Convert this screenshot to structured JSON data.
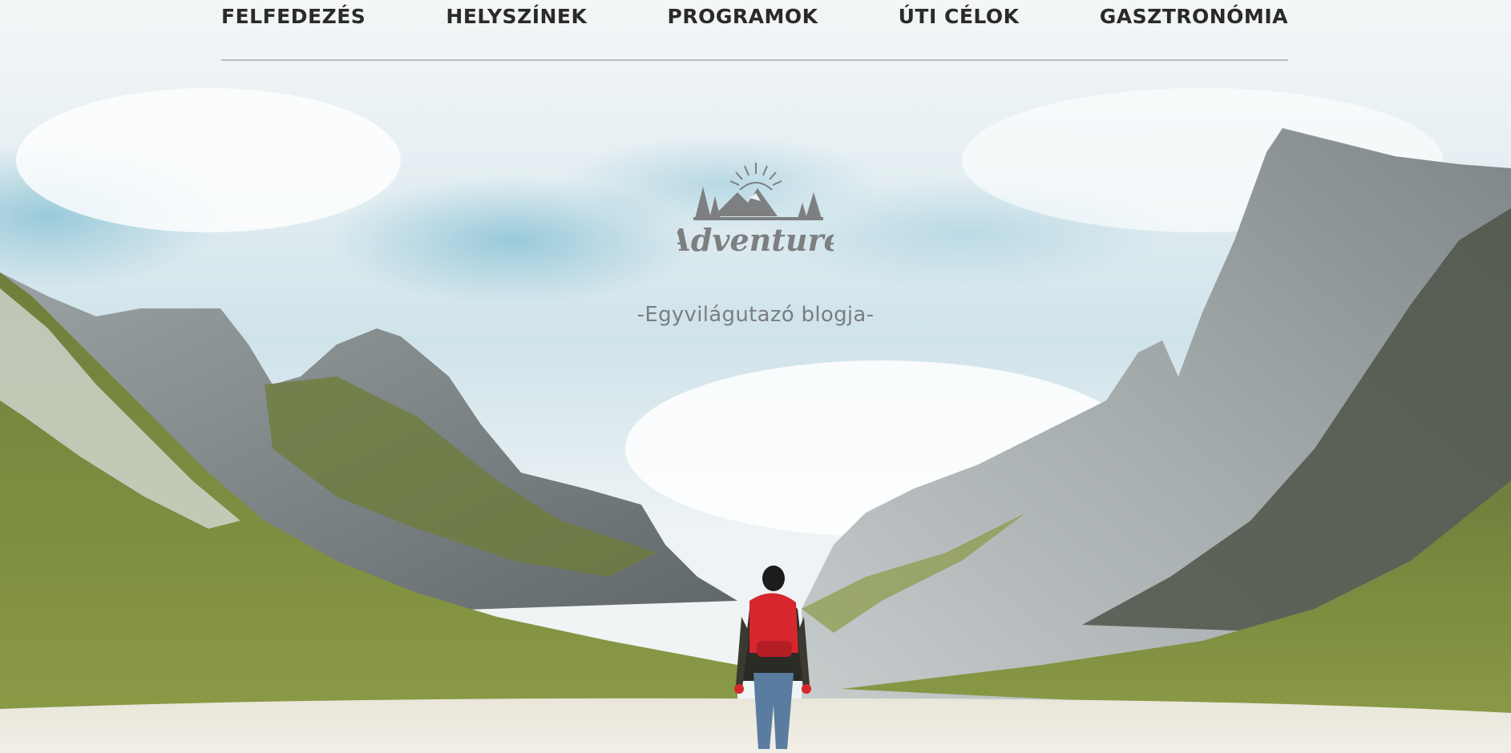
{
  "nav": {
    "items": [
      {
        "label": "FELFEDEZÉS"
      },
      {
        "label": "HELYSZÍNEK"
      },
      {
        "label": "PROGRAMOK"
      },
      {
        "label": "ÚTI CÉLOK"
      },
      {
        "label": "GASZTRONÓMIA"
      }
    ]
  },
  "brand": {
    "logo_text": "Adventure",
    "tagline": "-Egyvilágutazó blogja-"
  },
  "colors": {
    "nav_text": "#2a2a2a",
    "divider": "#b9bdc0",
    "logo": "#7d7f80",
    "backpack": "#d8262f"
  }
}
